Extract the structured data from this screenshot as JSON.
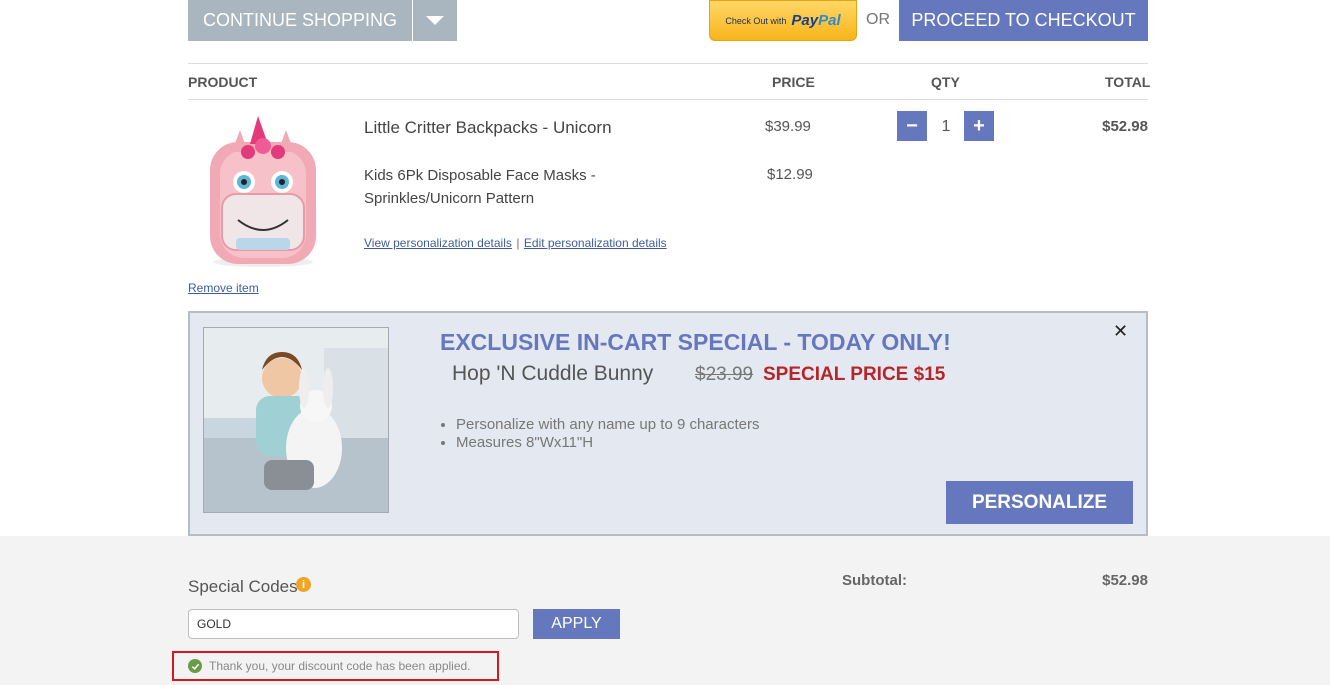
{
  "top_actions": {
    "continue_label": "CONTINUE SHOPPING",
    "paypal_prefix": "Check Out with",
    "paypal_logo_a": "Pay",
    "paypal_logo_b": "Pal",
    "or_label": "OR",
    "checkout_label": "PROCEED TO CHECKOUT"
  },
  "table": {
    "headers": {
      "product": "PRODUCT",
      "price": "PRICE",
      "qty": "QTY",
      "total": "TOTAL"
    }
  },
  "cart_item": {
    "name": "Little Critter Backpacks - Unicorn",
    "price": "$39.99",
    "addon_name": "Kids 6Pk Disposable Face Masks - Sprinkles/Unicorn Pattern",
    "addon_price": "$12.99",
    "qty": "1",
    "minus": "−",
    "plus": "+",
    "total": "$52.98",
    "view_link": "View personalization details",
    "separator": "|",
    "edit_link": "Edit personalization details",
    "remove_link": "Remove item"
  },
  "promo": {
    "title": "EXCLUSIVE IN-CART SPECIAL - TODAY ONLY!",
    "item_name": "Hop 'N Cuddle Bunny",
    "old_price": "$23.99",
    "special_price": "SPECIAL PRICE $15",
    "bullets": [
      "Personalize with any name up to 9 characters",
      "Measures 8\"Wx11\"H"
    ],
    "close_glyph": "✕",
    "button_label": "PERSONALIZE"
  },
  "codes": {
    "label": "Special Codes",
    "info_glyph": "i",
    "input_value": "GOLD",
    "apply_label": "APPLY",
    "applied_message": "Thank you, your discount code has been applied."
  },
  "summary": {
    "subtotal_label": "Subtotal:",
    "subtotal_value": "$52.98"
  },
  "colors": {
    "accent": "#6678bd",
    "gray_button": "#a9b6bf",
    "special_red": "#b5262a",
    "alert_border": "#d4191f"
  }
}
